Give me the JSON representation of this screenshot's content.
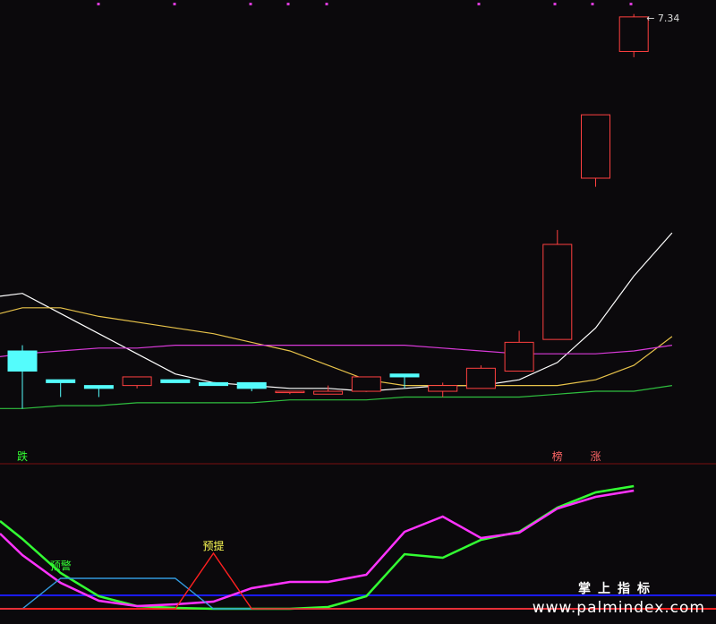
{
  "chart_data": [
    {
      "type": "candlestick",
      "panel": "main",
      "price_label": "7.34",
      "marker_labels": [
        {
          "text": "跌",
          "color": "#33ff33",
          "index": 1
        },
        {
          "text": "榜",
          "color": "#ff6666",
          "index": 15
        },
        {
          "text": "涨",
          "color": "#ff6666",
          "index": 16
        }
      ],
      "up_color": "#ff4040",
      "down_color": "#54fcfc",
      "candles": [
        {
          "o": 5.95,
          "h": 6.4,
          "l": 5.99,
          "c": 6.38
        },
        {
          "o": 6.18,
          "h": 6.2,
          "l": 5.98,
          "c": 6.11
        },
        {
          "o": 6.08,
          "h": 6.05,
          "l": 6.02,
          "c": 6.07
        },
        {
          "o": 6.06,
          "h": 6.06,
          "l": 6.02,
          "c": 6.05
        },
        {
          "o": 6.06,
          "h": 6.05,
          "l": 6.05,
          "c": 6.09
        },
        {
          "o": 6.08,
          "h": 6.05,
          "l": 6.07,
          "c": 6.07
        },
        {
          "o": 6.07,
          "h": 6.06,
          "l": 6.06,
          "c": 6.06
        },
        {
          "o": 6.07,
          "h": 6.07,
          "l": 6.04,
          "c": 6.05
        },
        {
          "o": 6.04,
          "h": 6.04,
          "l": 6.03,
          "c": 6.04
        },
        {
          "o": 6.03,
          "h": 6.06,
          "l": 6.04,
          "c": 6.04
        },
        {
          "o": 6.04,
          "h": 6.09,
          "l": 6.04,
          "c": 6.09
        },
        {
          "o": 6.1,
          "h": 6.1,
          "l": 6.05,
          "c": 6.09
        },
        {
          "o": 6.04,
          "h": 6.07,
          "l": 6.02,
          "c": 6.06
        },
        {
          "o": 6.05,
          "h": 6.13,
          "l": 6.05,
          "c": 6.12
        },
        {
          "o": 6.11,
          "h": 6.25,
          "l": 6.11,
          "c": 6.21
        },
        {
          "o": 6.22,
          "h": 6.6,
          "l": 6.22,
          "c": 6.55
        },
        {
          "o": 6.78,
          "h": 6.8,
          "l": 6.75,
          "c": 7.0
        },
        {
          "o": 7.22,
          "h": 7.35,
          "l": 7.2,
          "c": 7.34
        }
      ],
      "moving_averages": [
        {
          "color": "#ffffff",
          "values": [
            6.37,
            6.38,
            6.31,
            6.24,
            6.17,
            6.1,
            6.07,
            6.06,
            6.05,
            6.05,
            6.04,
            6.05,
            6.06,
            6.06,
            6.08,
            6.14,
            6.26,
            6.44,
            6.59
          ]
        },
        {
          "color": "#e8c34a",
          "values": [
            6.31,
            6.33,
            6.33,
            6.3,
            6.28,
            6.26,
            6.24,
            6.21,
            6.18,
            6.13,
            6.08,
            6.06,
            6.06,
            6.06,
            6.06,
            6.06,
            6.08,
            6.13,
            6.23
          ]
        },
        {
          "color": "#d93ad9",
          "values": [
            6.16,
            6.17,
            6.18,
            6.19,
            6.19,
            6.2,
            6.2,
            6.2,
            6.2,
            6.2,
            6.2,
            6.2,
            6.19,
            6.18,
            6.17,
            6.17,
            6.17,
            6.18,
            6.2
          ]
        },
        {
          "color": "#2fbf3f",
          "values": [
            5.98,
            5.98,
            5.99,
            5.99,
            6.0,
            6.0,
            6.0,
            6.0,
            6.01,
            6.01,
            6.01,
            6.02,
            6.02,
            6.02,
            6.02,
            6.03,
            6.04,
            6.04,
            6.06
          ]
        }
      ]
    },
    {
      "type": "line",
      "panel": "indicator",
      "labels": [
        {
          "text": "预警",
          "color": "#33ff33",
          "index": 2
        },
        {
          "text": "预提",
          "color": "#ffff55",
          "index": 6
        }
      ],
      "series": [
        {
          "color": "#33ff33",
          "values": [
            98,
            78,
            40,
            14,
            3,
            1,
            0,
            0,
            0,
            2,
            14,
            61,
            57,
            77,
            86,
            113,
            130,
            137
          ]
        },
        {
          "color": "#ff33ff",
          "values": [
            84,
            60,
            29,
            9,
            3,
            5,
            8,
            23,
            30,
            30,
            38,
            86,
            103,
            79,
            85,
            112,
            125,
            132
          ]
        },
        {
          "color": "#3399dd",
          "values": [
            0,
            0,
            34,
            34,
            34,
            34,
            0,
            0,
            0,
            0,
            0,
            0,
            0,
            0,
            0,
            0,
            0,
            0
          ]
        },
        {
          "color": "#ff2020",
          "values": [
            0,
            0,
            0,
            0,
            0,
            0,
            62,
            0,
            0,
            0,
            0,
            0,
            0,
            0,
            0,
            0,
            0,
            0
          ]
        }
      ],
      "reference_lines": [
        {
          "color": "#1a1aff",
          "value": 15
        },
        {
          "color": "#ff2020",
          "value": 0
        }
      ]
    }
  ],
  "watermark": {
    "cn": "掌上指标",
    "url": "www.palmindex.com"
  }
}
